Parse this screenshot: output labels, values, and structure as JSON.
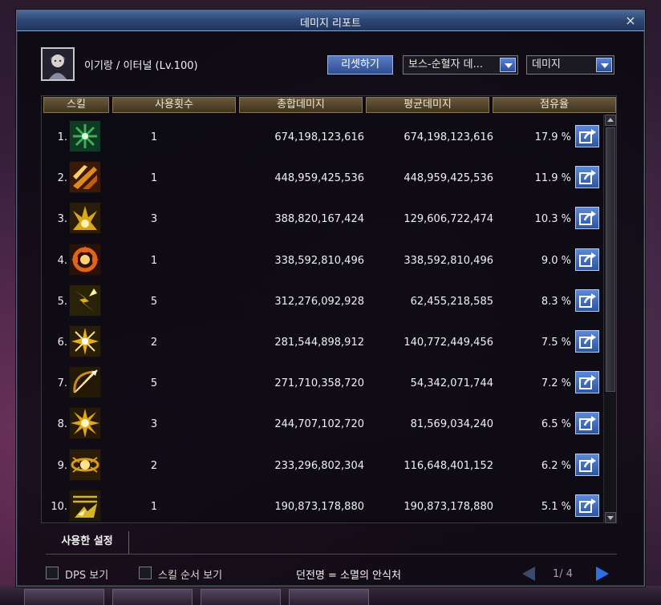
{
  "window": {
    "title": "데미지 리포트",
    "close_label": "×"
  },
  "character": {
    "name_line": "이기랑 / 이터널 (Lv.100)"
  },
  "controls": {
    "reset_label": "리셋하기",
    "target_dropdown": "보스-순혈자 데...",
    "metric_dropdown": "데미지"
  },
  "table": {
    "headers": [
      "스킬",
      "사용횟수",
      "총합데미지",
      "평균데미지",
      "점유율"
    ],
    "rows": [
      {
        "rank": "1.",
        "count": "1",
        "total": "674,198,123,616",
        "avg": "674,198,123,616",
        "share": "17.9 %",
        "icon": "ice-snowflake-skill-icon",
        "color": "#3fae56"
      },
      {
        "rank": "2.",
        "count": "1",
        "total": "448,959,425,536",
        "avg": "448,959,425,536",
        "share": "11.9 %",
        "icon": "fire-slash-skill-icon",
        "color": "#e08a1e"
      },
      {
        "rank": "3.",
        "count": "3",
        "total": "388,820,167,424",
        "avg": "129,606,722,474",
        "share": "10.3 %",
        "icon": "flame-burst-skill-icon",
        "color": "#d8a81a"
      },
      {
        "rank": "4.",
        "count": "1",
        "total": "338,592,810,496",
        "avg": "338,592,810,496",
        "share": "9.0 %",
        "icon": "fire-vortex-skill-icon",
        "color": "#e0641c"
      },
      {
        "rank": "5.",
        "count": "5",
        "total": "312,276,092,928",
        "avg": "62,455,218,585",
        "share": "8.3 %",
        "icon": "lightning-shards-skill-icon",
        "color": "#d8b020"
      },
      {
        "rank": "6.",
        "count": "2",
        "total": "281,544,898,912",
        "avg": "140,772,449,456",
        "share": "7.5 %",
        "icon": "star-explosion-skill-icon",
        "color": "#e8b018"
      },
      {
        "rank": "7.",
        "count": "5",
        "total": "271,710,358,720",
        "avg": "54,342,071,744",
        "share": "7.2 %",
        "icon": "bow-arrow-skill-icon",
        "color": "#c88a22"
      },
      {
        "rank": "8.",
        "count": "3",
        "total": "244,707,102,720",
        "avg": "81,569,034,240",
        "share": "6.5 %",
        "icon": "sun-burst-skill-icon",
        "color": "#e0a818"
      },
      {
        "rank": "9.",
        "count": "2",
        "total": "233,296,802,304",
        "avg": "116,648,401,152",
        "share": "6.2 %",
        "icon": "winged-orb-skill-icon",
        "color": "#d89c1c"
      },
      {
        "rank": "10.",
        "count": "1",
        "total": "190,873,178,880",
        "avg": "190,873,178,880",
        "share": "5.1 %",
        "icon": "light-beam-skill-icon",
        "color": "#d8b428"
      }
    ]
  },
  "footer": {
    "tab_label": "사용한 설정",
    "dps_label": "DPS 보기",
    "order_label": "스킬 순서 보기",
    "dungeon_text": "던전명 = 소멸의 안식처",
    "page_text": "1/ 4"
  },
  "colors": {
    "title_bar": "#2c4674",
    "header_bg": "#5a4a2e",
    "button_blue": "#3a62b0"
  }
}
